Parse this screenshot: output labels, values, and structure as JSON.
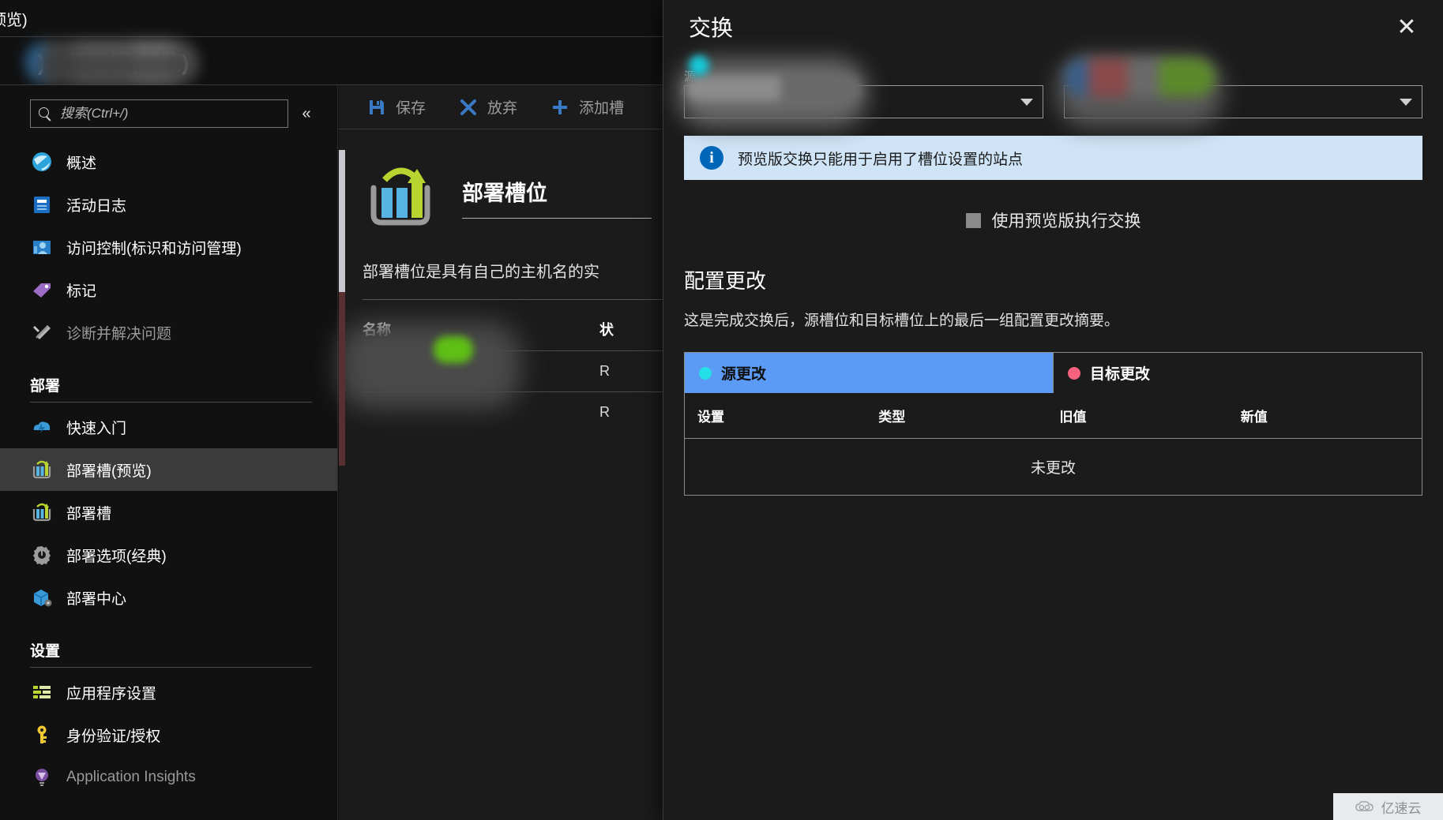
{
  "breadcrumb": {
    "text": "预览)"
  },
  "page": {
    "title_suffix": ") - 部署槽(预览)"
  },
  "search": {
    "placeholder": "搜索(Ctrl+/)",
    "value": "",
    "collapse_icon": "chevron-double-left-icon"
  },
  "sidebar": {
    "items": [
      {
        "label": "概述",
        "icon": "overview-globe-icon",
        "dim": false,
        "selected": false
      },
      {
        "label": "活动日志",
        "icon": "activity-log-icon",
        "dim": false,
        "selected": false
      },
      {
        "label": "访问控制(标识和访问管理)",
        "icon": "access-control-icon",
        "dim": false,
        "selected": false
      },
      {
        "label": "标记",
        "icon": "tag-icon",
        "dim": false,
        "selected": false
      },
      {
        "label": "诊断并解决问题",
        "icon": "wrench-icon",
        "dim": true,
        "selected": false
      }
    ],
    "groups": [
      {
        "title": "部署",
        "items": [
          {
            "label": "快速入门",
            "icon": "quickstart-cloud-icon",
            "dim": false,
            "selected": false
          },
          {
            "label": "部署槽(预览)",
            "icon": "deployment-slot-icon",
            "dim": false,
            "selected": true
          },
          {
            "label": "部署槽",
            "icon": "deployment-slot-icon",
            "dim": false,
            "selected": false
          },
          {
            "label": "部署选项(经典)",
            "icon": "gear-icon",
            "dim": false,
            "selected": false
          },
          {
            "label": "部署中心",
            "icon": "deployment-center-box-icon",
            "dim": false,
            "selected": false
          }
        ]
      },
      {
        "title": "设置",
        "items": [
          {
            "label": "应用程序设置",
            "icon": "app-settings-icon",
            "dim": false,
            "selected": false
          },
          {
            "label": "身份验证/授权",
            "icon": "key-icon",
            "dim": false,
            "selected": false
          },
          {
            "label": "Application Insights",
            "icon": "app-insights-bulb-icon",
            "dim": true,
            "selected": false
          }
        ]
      }
    ]
  },
  "toolbar": {
    "save_label": "保存",
    "discard_label": "放弃",
    "add_slot_label": "添加槽"
  },
  "main": {
    "hero_title": "部署槽位",
    "hero_desc": "部署槽位是具有自己的主机名的实",
    "table": {
      "columns": [
        "名称",
        "状"
      ],
      "rows": [
        {
          "name": "",
          "status": "R"
        },
        {
          "name": "",
          "status": "R"
        }
      ]
    }
  },
  "blade": {
    "title": "交换",
    "close_icon": "close-icon",
    "source_select": {
      "label": "源",
      "value": ""
    },
    "target_select": {
      "label": "",
      "value": ""
    },
    "info": {
      "icon": "info-icon",
      "text": "预览版交换只能用于启用了槽位设置的站点"
    },
    "checkbox": {
      "label": "使用预览版执行交换",
      "checked": true
    },
    "section": {
      "title": "配置更改",
      "description": "这是完成交换后，源槽位和目标槽位上的最后一组配置更改摘要。"
    },
    "tabs": [
      {
        "label": "源更改",
        "dot_color": "#22e0e6",
        "active": true
      },
      {
        "label": "目标更改",
        "dot_color": "#f4627f",
        "active": false
      }
    ],
    "changes_table": {
      "columns": [
        "设置",
        "类型",
        "旧值",
        "新值"
      ],
      "empty_text": "未更改"
    }
  },
  "watermark": {
    "text": "亿速云",
    "icon": "cloud-icon"
  },
  "colors": {
    "accent_blue": "#5b9bf5",
    "info_bg": "#cfe4f7",
    "info_icon": "#0067b8",
    "selected_nav": "#3b3b3b"
  }
}
